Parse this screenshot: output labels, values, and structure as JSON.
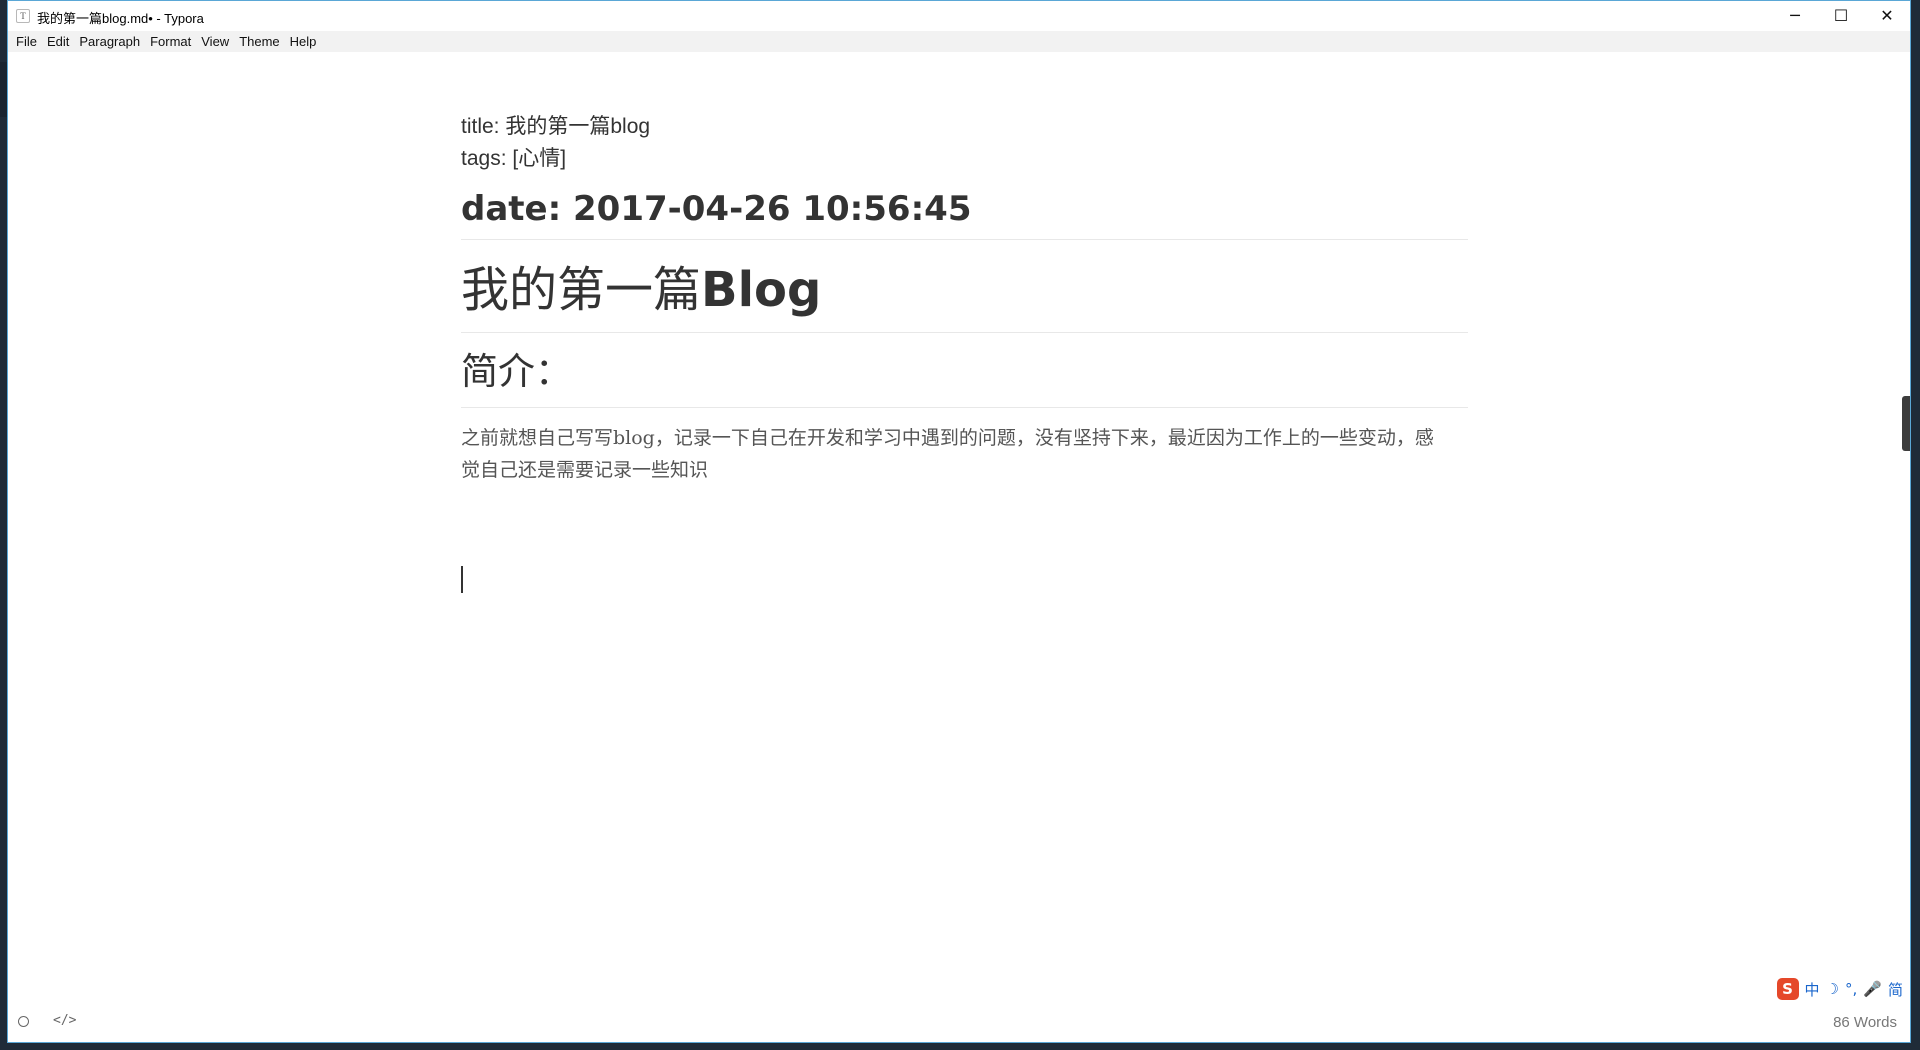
{
  "window": {
    "title": "我的第一篇blog.md• - Typora",
    "app_icon_glyph": "T",
    "controls": {
      "minimize": "─",
      "maximize": "☐",
      "close": "✕"
    }
  },
  "menu": {
    "items": [
      {
        "label": "File"
      },
      {
        "label": "Edit"
      },
      {
        "label": "Paragraph"
      },
      {
        "label": "Format"
      },
      {
        "label": "View"
      },
      {
        "label": "Theme"
      },
      {
        "label": "Help"
      }
    ]
  },
  "document": {
    "title_line": "title: 我的第一篇blog",
    "tags_line": "tags: [心情]",
    "date_heading": "date: 2017-04-26 10:56:45",
    "h1_cn": "我的第一篇",
    "h1_en": "Blog",
    "h3": "简介：",
    "paragraph": "之前就想自己写写blog，记录一下自己在开发和学习中遇到的问题，没有坚持下来，最近因为工作上的一些变动，感觉自己还是需要记录一些知识"
  },
  "statusbar": {
    "code_toggle": "</>",
    "word_count": "86 Words"
  },
  "ime": {
    "logo": "S",
    "items": [
      "中",
      "☽",
      "°,",
      "🎤",
      "简"
    ]
  }
}
